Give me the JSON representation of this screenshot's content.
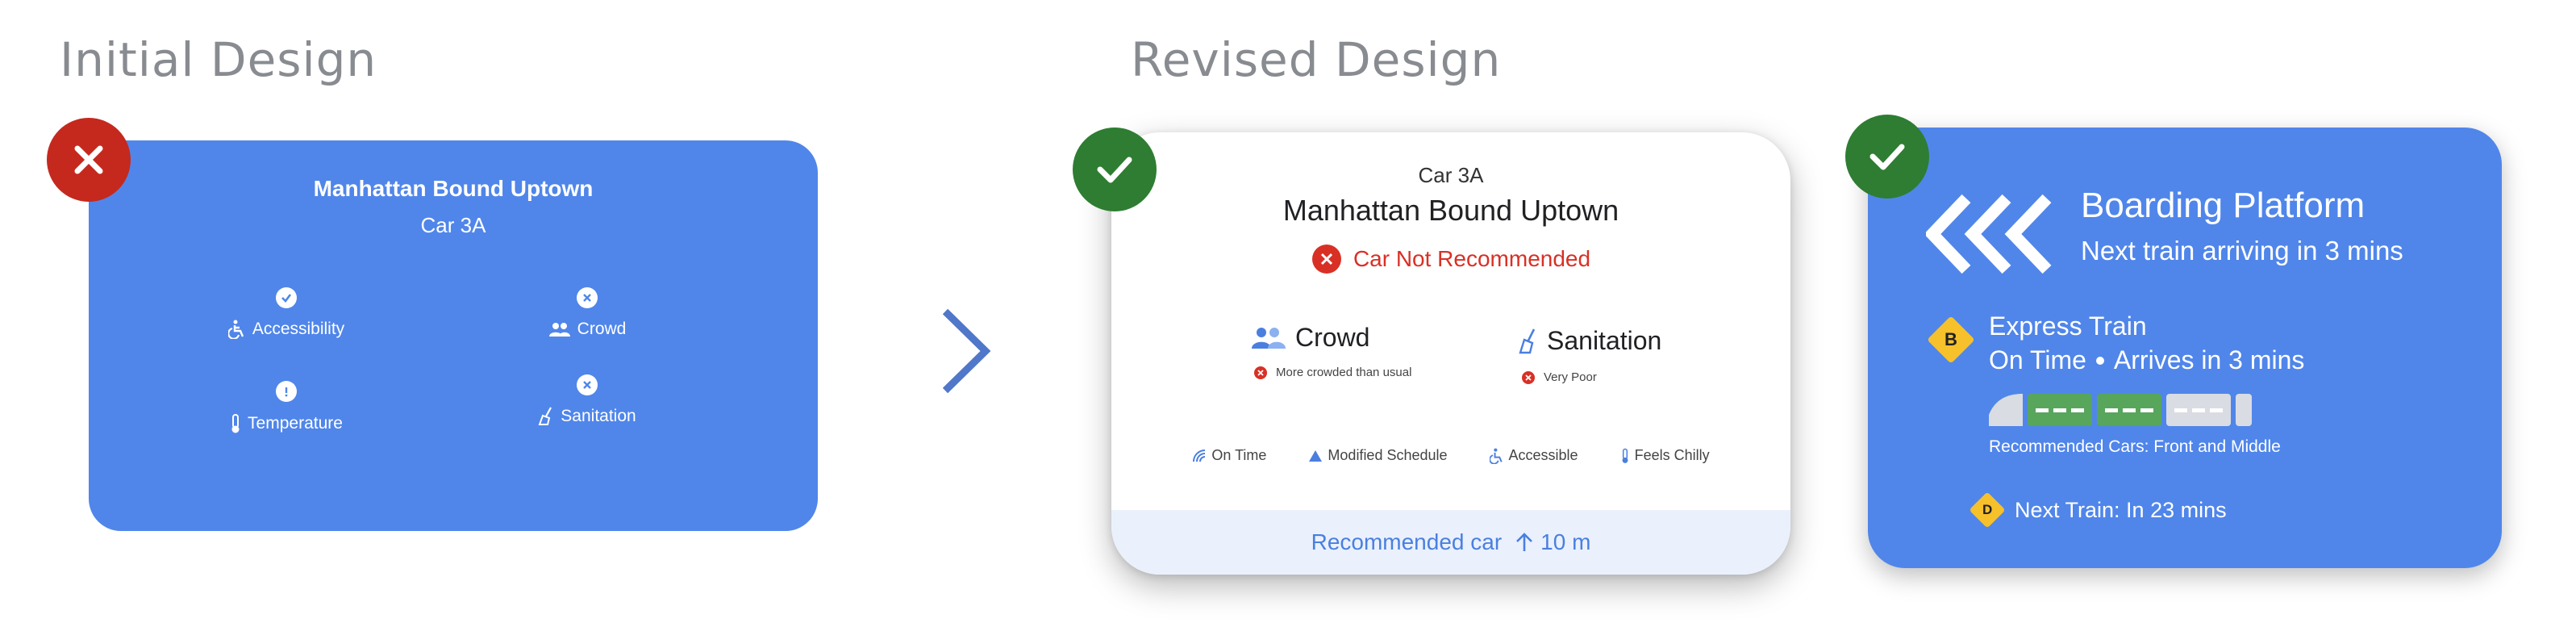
{
  "titles": {
    "initial": "Initial Design",
    "revised": "Revised Design"
  },
  "colors": {
    "card_blue": "#5086ea",
    "bad": "#c5291e",
    "good": "#2e7d32",
    "warn_red": "#d93025",
    "route_yellow": "#f6c12a",
    "rec_green": "#58a55c"
  },
  "initial_card": {
    "title": "Manhattan Bound  Uptown",
    "car": "Car 3A",
    "attributes": [
      {
        "label": "Accessibility",
        "icon": "accessible-icon",
        "status": "check-icon"
      },
      {
        "label": "Crowd",
        "icon": "people-icon",
        "status": "x-icon"
      },
      {
        "label": "Temperature",
        "icon": "thermometer-icon",
        "status": "info-icon"
      },
      {
        "label": "Sanitation",
        "icon": "broom-icon",
        "status": "x-icon"
      }
    ]
  },
  "revised_card": {
    "car": "Car 3A",
    "title": "Manhattan Bound  Uptown",
    "warning": "Car Not Recommended",
    "crowd": {
      "label": "Crowd",
      "detail": "More crowded than usual"
    },
    "sanitation": {
      "label": "Sanitation",
      "detail": "Very Poor"
    },
    "chips": [
      "On Time",
      "Modified  Schedule",
      "Accessible",
      "Feels Chilly"
    ],
    "footer": {
      "label": "Recommended car",
      "distance": "10 m"
    }
  },
  "platform_card": {
    "title": "Boarding Platform",
    "subtitle": "Next train arriving in 3 mins",
    "express": {
      "route": "B",
      "title": "Express Train",
      "status": "On Time",
      "arrival": "Arrives in 3 mins"
    },
    "train_cars": [
      "grey",
      "green",
      "green",
      "grey",
      "grey"
    ],
    "recommended_cars": "Recommended Cars: Front and Middle",
    "next": {
      "route": "D",
      "text": "Next Train: In 23 mins"
    }
  }
}
